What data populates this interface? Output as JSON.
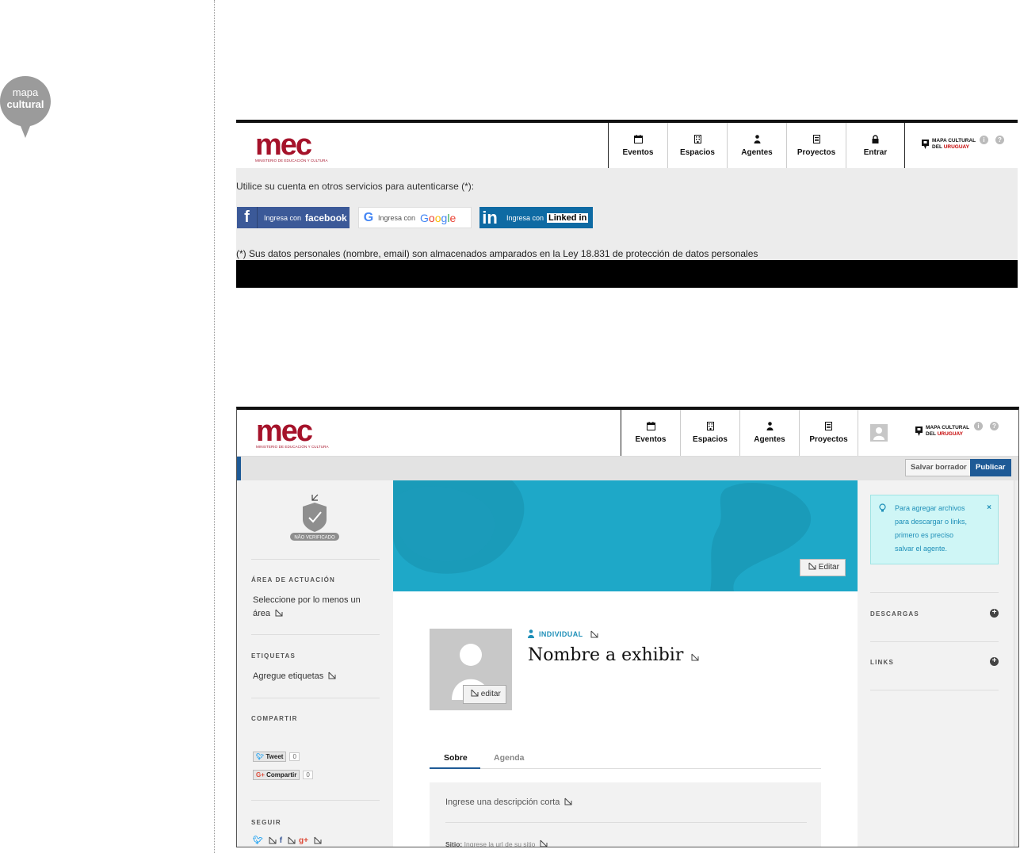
{
  "mapa_cultural_logo": {
    "line1": "mapa",
    "line2": "cultural"
  },
  "mec_logo": {
    "word": "mec",
    "sub": "MINISTERIO DE EDUCACIÓN Y CULTURA"
  },
  "mcu_logo": {
    "line1": "MAPA CULTURAL",
    "line2a": "DEL ",
    "line2b": "URUGUAY"
  },
  "nav1": {
    "eventos": "Eventos",
    "espacios": "Espacios",
    "agentes": "Agentes",
    "proyectos": "Proyectos",
    "entrar": "Entrar"
  },
  "login": {
    "instruction": "Utilice su cuenta en otros servicios para autenticarse (*):",
    "facebook_prefix": "Ingresa con",
    "facebook_brand": "facebook",
    "google_prefix": "Ingresa con",
    "google_brand": [
      "G",
      "o",
      "o",
      "g",
      "l",
      "e"
    ],
    "linkedin_prefix": "Ingresa con",
    "linkedin_brand": "Linked in",
    "disclaimer": "(*) Sus datos personales (nombre, email) son almacenados amparados en la Ley 18.831 de protección de datos personales"
  },
  "nav2": {
    "eventos": "Eventos",
    "espacios": "Espacios",
    "agentes": "Agentes",
    "proyectos": "Proyectos"
  },
  "actions": {
    "draft": "Salvar borrador",
    "publish": "Publicar"
  },
  "sidebar_left": {
    "badge": "NÃO VERIFICADO",
    "area_title": "ÁREA DE ACTUACIÓN",
    "area_text_1": "Seleccione por lo menos un",
    "area_text_2": "área",
    "tags_title": "ETIQUETAS",
    "tags_text": "Agregue etiquetas",
    "share_title": "COMPARTIR",
    "tweet": "Tweet",
    "tweet_count": "0",
    "gplus": "Compartir",
    "gplus_count": "0",
    "follow_title": "SEGUIR"
  },
  "cover": {
    "edit": "Editar"
  },
  "profile": {
    "pic_edit": "editar",
    "type": "INDIVIDUAL",
    "name": "Nombre a exhibir"
  },
  "tabs": [
    "Sobre",
    "Agenda"
  ],
  "description": {
    "placeholder": "Ingrese una descripción corta",
    "site_label": "Sitio:",
    "site_placeholder": "Ingrese la url de su sitio"
  },
  "sidebar_right": {
    "tip_lines": [
      "Para agregar archivos",
      "para descargar o links,",
      "primero es preciso",
      "salvar el agente."
    ],
    "tip_close": "×",
    "downloads": "DESCARGAS",
    "links": "LINKS"
  },
  "colors": {
    "mec_red": "#a5122a",
    "cover": "#1ea8c8",
    "publish": "#1e5a96",
    "tip_bg": "#cff6f6"
  }
}
